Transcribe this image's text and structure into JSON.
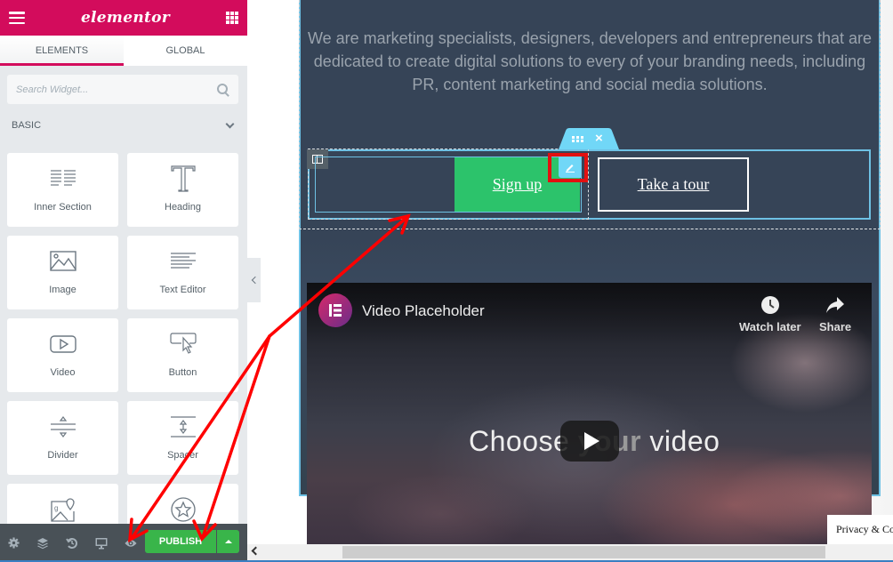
{
  "panel": {
    "logo": "elementor",
    "tabs": [
      {
        "label": "ELEMENTS",
        "active": true
      },
      {
        "label": "GLOBAL",
        "active": false
      }
    ],
    "search": {
      "placeholder": "Search Widget...",
      "value": ""
    },
    "category": "BASIC",
    "widgets": [
      {
        "label": "Inner Section",
        "icon": "inner-section-icon"
      },
      {
        "label": "Heading",
        "icon": "heading-icon"
      },
      {
        "label": "Image",
        "icon": "image-icon"
      },
      {
        "label": "Text Editor",
        "icon": "text-editor-icon"
      },
      {
        "label": "Video",
        "icon": "video-icon"
      },
      {
        "label": "Button",
        "icon": "button-icon"
      },
      {
        "label": "Divider",
        "icon": "divider-icon"
      },
      {
        "label": "Spacer",
        "icon": "spacer-icon"
      },
      {
        "label": "Google Maps",
        "icon": "google-maps-icon"
      },
      {
        "label": "Icon",
        "icon": "star-icon"
      }
    ],
    "footer": {
      "icons": [
        "settings-icon",
        "navigator-layers-icon",
        "history-icon",
        "responsive-mode-icon",
        "preview-eye-icon"
      ],
      "publish_label": "PUBLISH"
    }
  },
  "canvas": {
    "intro_text": "We are marketing specialists, designers, developers and entrepreneurs that are dedicated to create digital solutions to every of your branding needs, including PR, content marketing and social media solutions.",
    "buttons": {
      "primary_label": "Sign up",
      "secondary_label": "Take a tour"
    },
    "video": {
      "title": "Video Placeholder",
      "watch_later_label": "Watch later",
      "share_label": "Share",
      "overlay_text_before": "Choose ",
      "overlay_text_bold": "your",
      "overlay_text_after": " video"
    },
    "privacy_notice": "Privacy & Cookies"
  },
  "colors": {
    "brand": "#d30c5c",
    "publish": "#39b54a",
    "signup": "#2cc36b",
    "selection": "#6ec1e4",
    "section_bg": "#364457",
    "annotation": "#e21010"
  }
}
